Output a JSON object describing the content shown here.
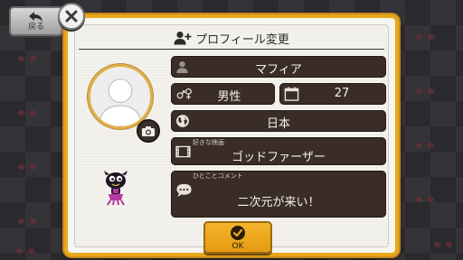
{
  "nav": {
    "back_label": "戻る"
  },
  "dialog": {
    "title": "プロフィール変更",
    "ok_label": "OK"
  },
  "profile": {
    "name": "マフィア",
    "gender": "男性",
    "age": "27",
    "country": "日本",
    "favorite_movie_label": "好きな映画",
    "favorite_movie": "ゴッドファーザー",
    "comment_label": "ひとことコメント",
    "comment": "二次元が来い！"
  },
  "icons": {
    "back": "back-arrow-icon",
    "close": "close-icon",
    "title": "add-user-icon",
    "camera": "camera-icon",
    "name": "person-icon",
    "gender": "gender-icon",
    "age": "calendar-icon",
    "country": "globe-icon",
    "movie": "film-icon",
    "comment": "speech-bubble-icon",
    "ok": "check-icon"
  },
  "colors": {
    "dialog_border": "#e7a81a",
    "field_bg": "#3a2d28",
    "ok_button": "#f0a91f",
    "background": "#2a2a2e"
  }
}
